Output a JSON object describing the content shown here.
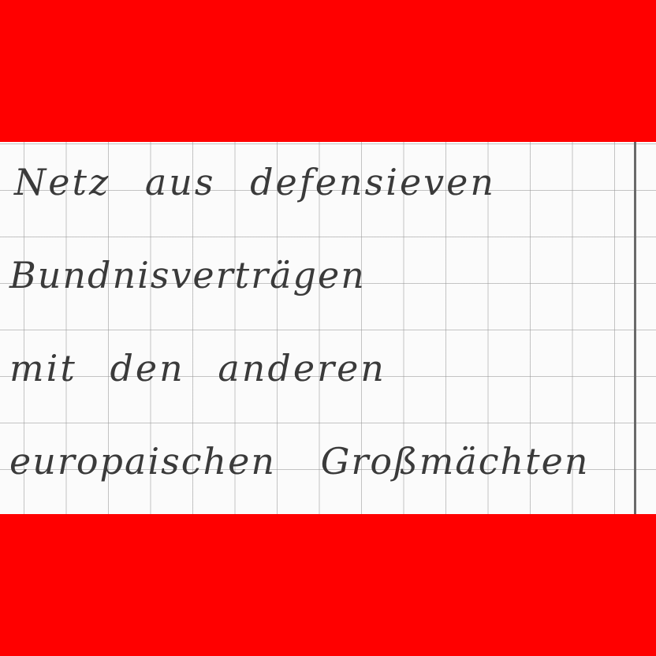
{
  "handwriting": {
    "lines": [
      "Netz aus defensieven",
      "Bundnisverträgen",
      "mit den anderen",
      "europaischen Großmächten"
    ]
  },
  "colors": {
    "band": "#ff0000",
    "paper": "#fbfbfb",
    "ink": "#3a3a3a",
    "grid": "#969696"
  }
}
